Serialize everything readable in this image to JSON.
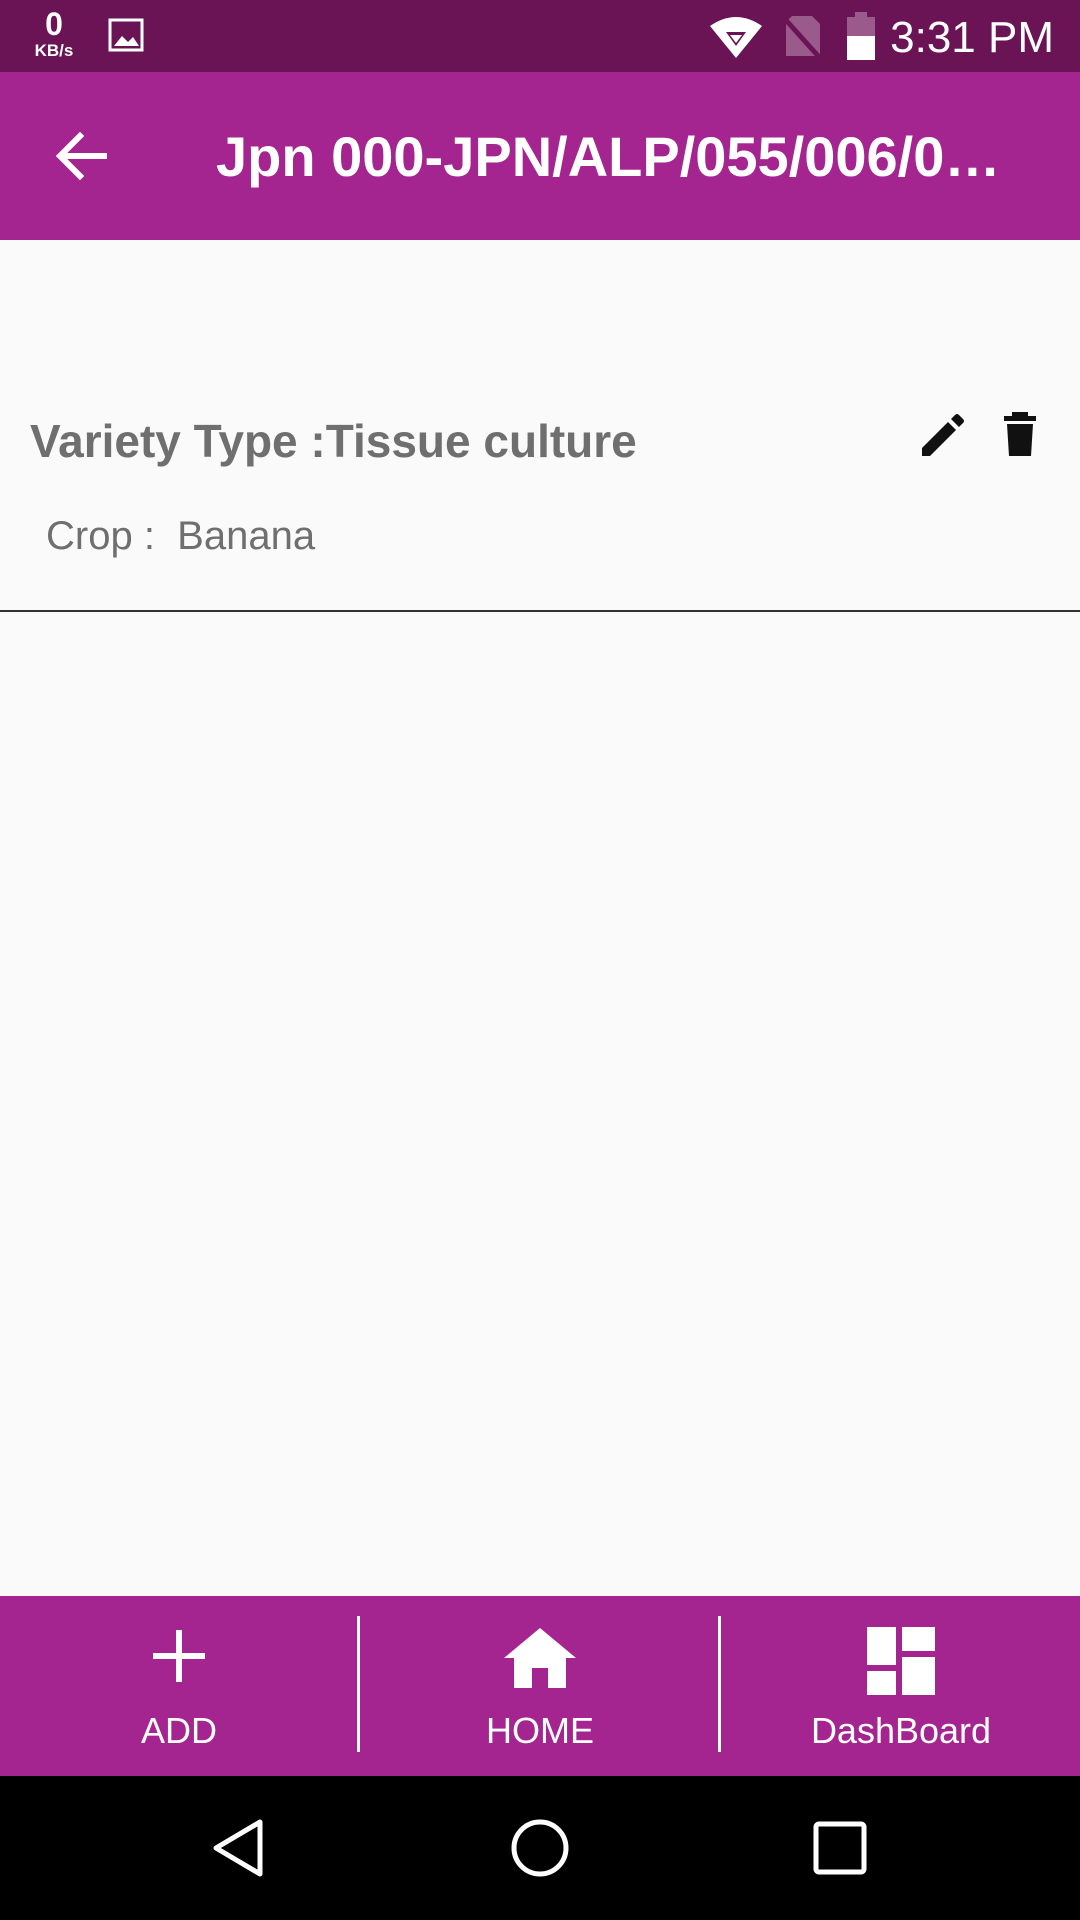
{
  "status_bar": {
    "speed_value": "0",
    "speed_unit": "KB/s",
    "time": "3:31 PM",
    "icons": [
      "image-notification-icon",
      "wifi-icon",
      "no-sim-icon",
      "battery-icon"
    ]
  },
  "app_bar": {
    "title": "Jpn 000-JPN/ALP/055/006/0…",
    "back_icon": "arrow-left-icon"
  },
  "record": {
    "variety_label": "Variety Type :Tissue culture",
    "crop_label": "Crop :  Banana",
    "actions": [
      "pencil-icon",
      "trash-icon"
    ]
  },
  "bottom_nav": {
    "add_label": "ADD",
    "home_label": "HOME",
    "dashboard_label": "DashBoard"
  },
  "system_nav": [
    "back-triangle-icon",
    "home-circle-icon",
    "recents-square-icon"
  ],
  "colors": {
    "status_bar": "#6a1456",
    "primary": "#a4258f",
    "text_gray": "#6f6f6f",
    "background": "#fafafa"
  }
}
